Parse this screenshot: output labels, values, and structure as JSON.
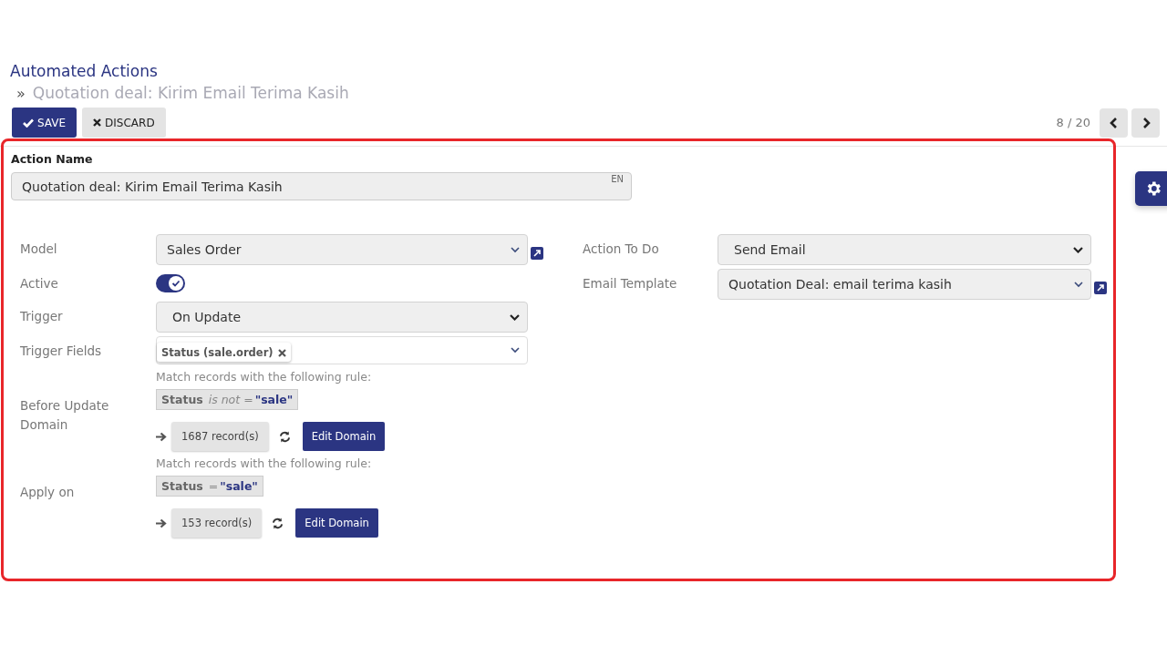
{
  "breadcrumb": {
    "parent": "Automated Actions",
    "separator": "»",
    "current": "Quotation deal: Kirim Email Terima Kasih"
  },
  "toolbar": {
    "buttons": [
      {
        "label": "SAVE",
        "kind": "primary"
      },
      {
        "label": "DISCARD",
        "kind": "secondary"
      }
    ],
    "pager": "8 / 20"
  },
  "form": {
    "name_label": "Action Name",
    "name_value": "Quotation deal: Kirim Email Terima Kasih",
    "lang": "EN",
    "left_fields": [
      {
        "label": "Model",
        "kind": "many2one",
        "value": "Sales Order"
      },
      {
        "label": "Active",
        "kind": "toggle",
        "on": true
      },
      {
        "label": "Trigger",
        "kind": "selection",
        "value": "On Update"
      },
      {
        "label": "Trigger Fields",
        "kind": "tags",
        "tags": [
          "Status (sale.order)"
        ]
      },
      {
        "label": "Before Update Domain",
        "kind": "domain",
        "hint": "Match records with the following rule:",
        "rule": {
          "field": "Status",
          "operator": "is not =",
          "value": "\"sale\""
        },
        "records": "1687 record(s)",
        "button": "Edit Domain"
      },
      {
        "label": "Apply on",
        "kind": "domain",
        "hint": "Match records with the following rule:",
        "rule": {
          "field": "Status",
          "operator": "=",
          "value": "\"sale\""
        },
        "records": "153 record(s)",
        "button": "Edit Domain"
      }
    ],
    "right_fields": [
      {
        "label": "Action To Do",
        "kind": "selection",
        "value": "Send Email"
      },
      {
        "label": "Email Template",
        "kind": "many2one",
        "value": "Quotation Deal: email terima kasih"
      }
    ]
  }
}
